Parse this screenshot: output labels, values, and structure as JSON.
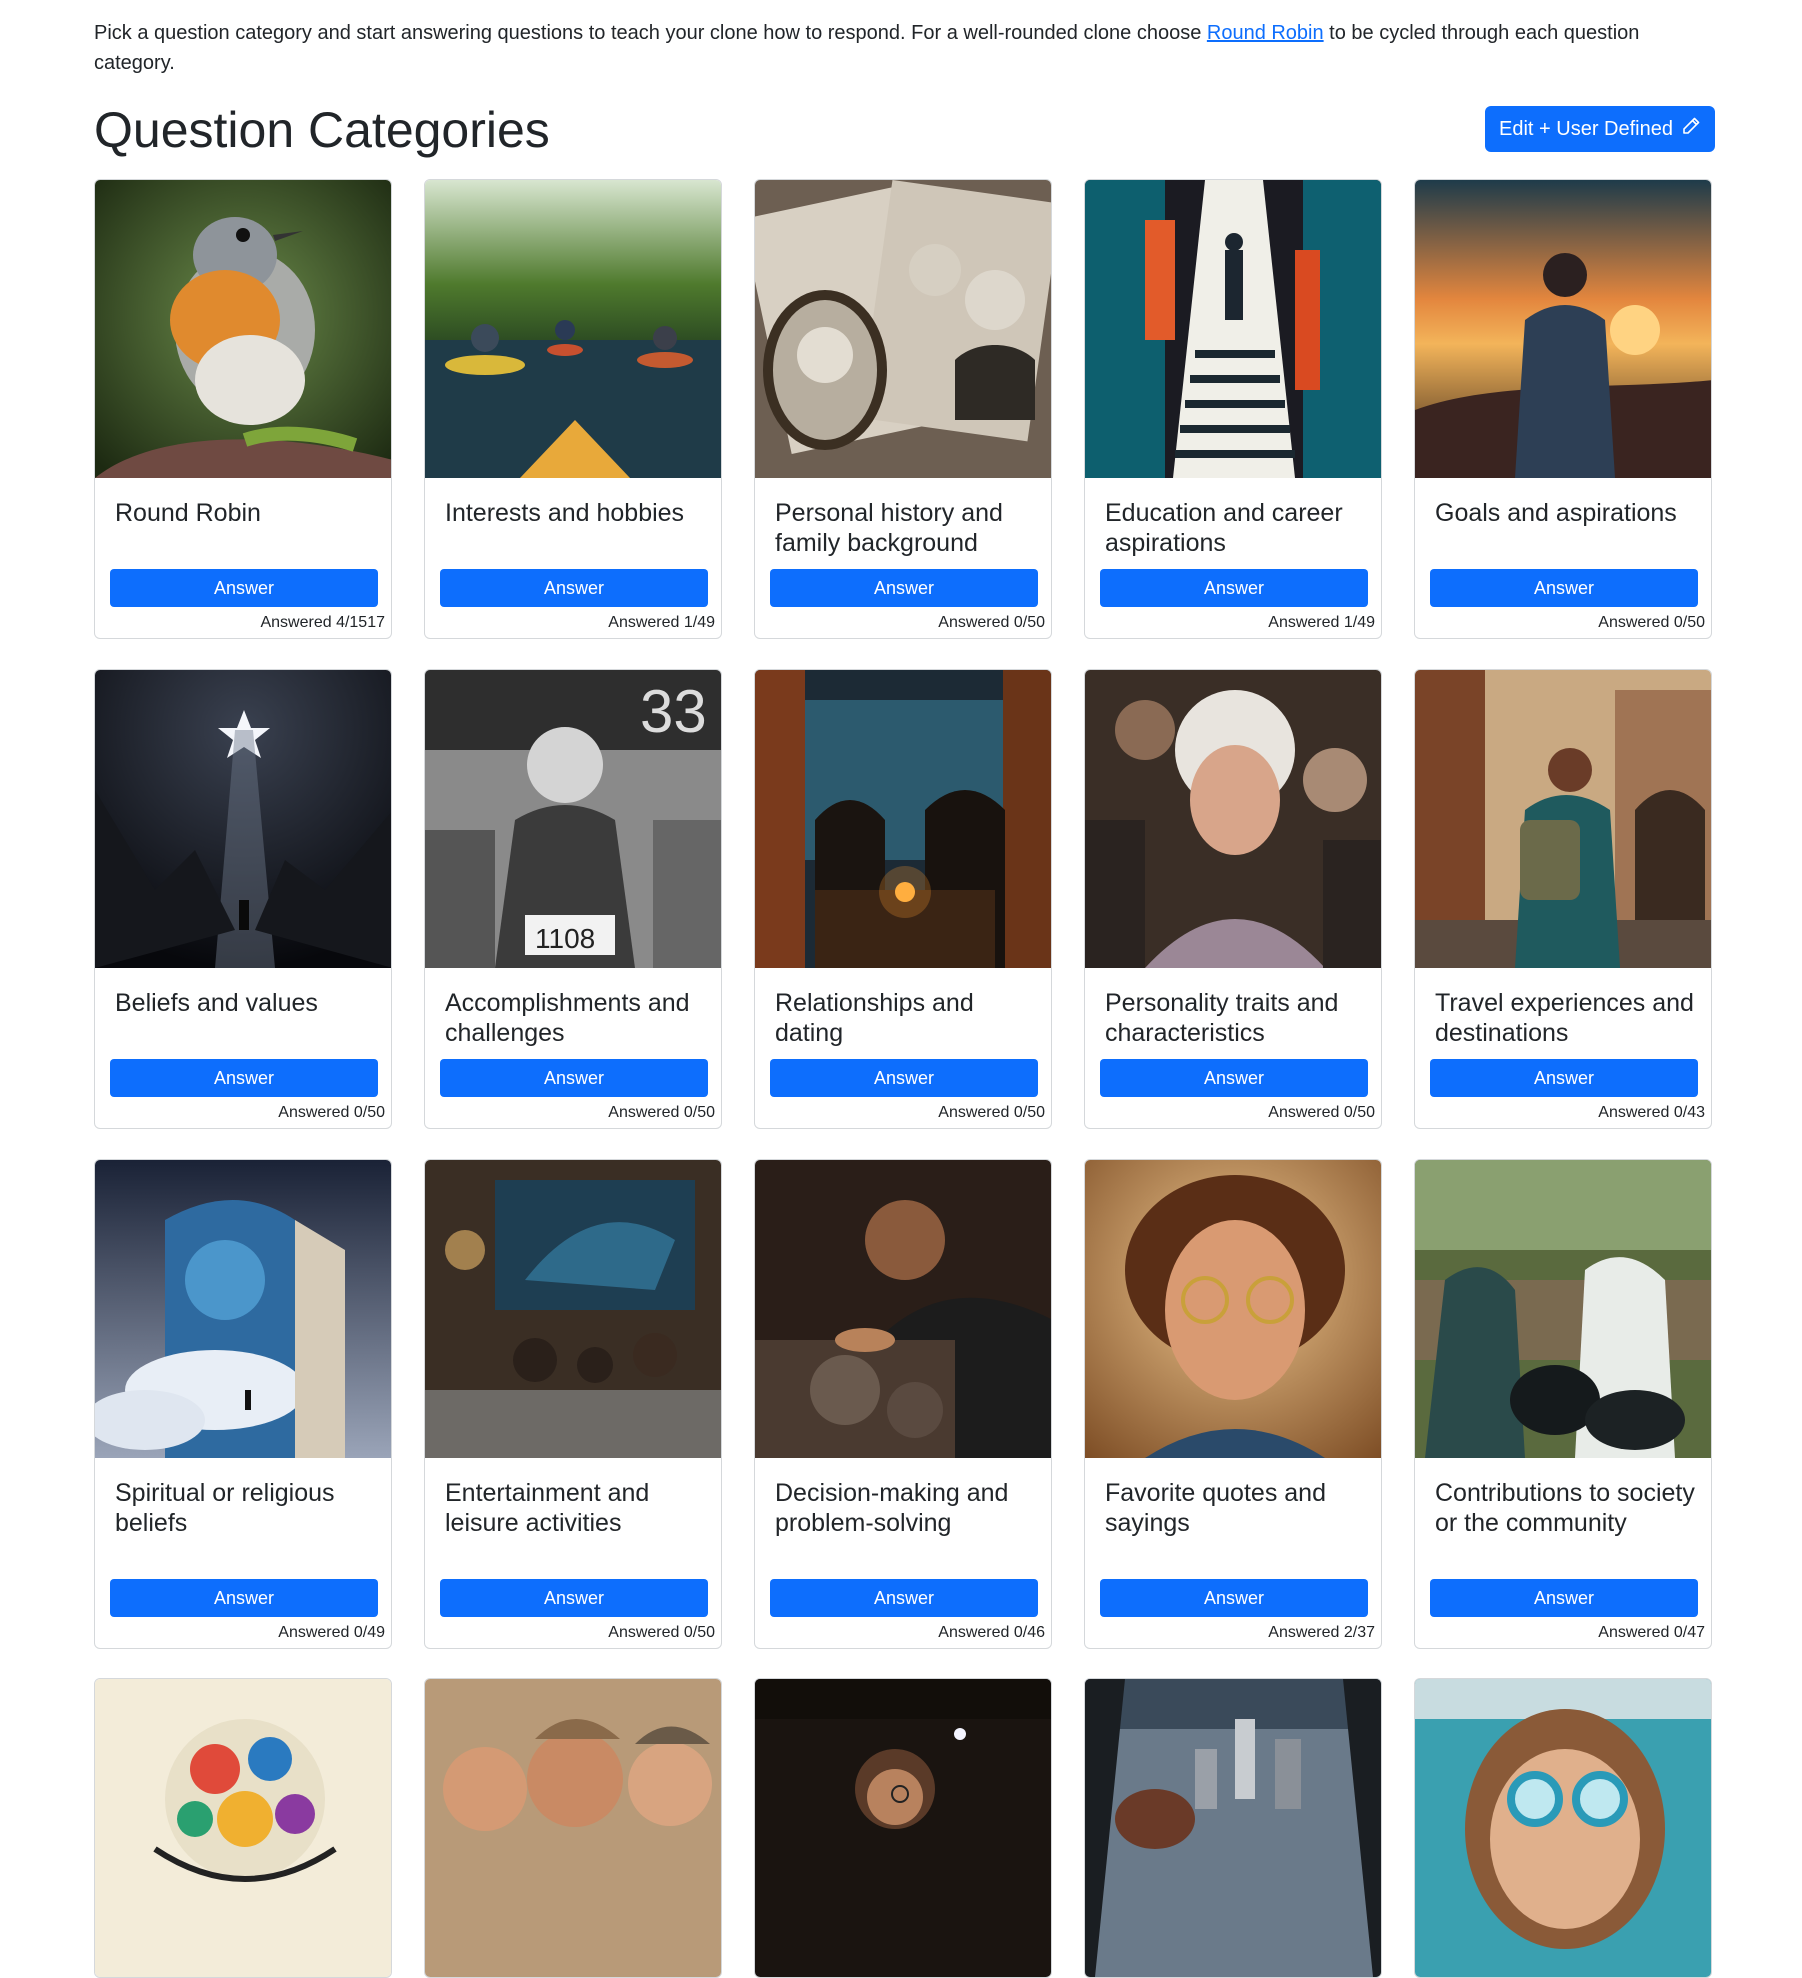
{
  "intro": {
    "before": "Pick a question category and start answering questions to teach your clone how to respond. For a well-rounded clone choose ",
    "link": "Round Robin",
    "after": " to be cycled through each question category."
  },
  "page_title": "Question Categories",
  "edit_button_label": "Edit + User Defined",
  "answer_label": "Answer",
  "categories": [
    {
      "title": "Round Robin",
      "answered": "Answered 4/1517",
      "icon": "robin-bird-photo"
    },
    {
      "title": "Interests and hobbies",
      "answered": "Answered 1/49",
      "icon": "kayakers-river-photo"
    },
    {
      "title": "Personal history and family background",
      "answered": "Answered 0/50",
      "icon": "vintage-family-portraits-photo"
    },
    {
      "title": "Education and career aspirations",
      "answered": "Answered 1/49",
      "icon": "man-climbing-stairs-art"
    },
    {
      "title": "Goals and aspirations",
      "answered": "Answered 0/50",
      "icon": "person-at-sunset-photo"
    },
    {
      "title": "Beliefs and values",
      "answered": "Answered 0/50",
      "icon": "star-over-mountains-photo"
    },
    {
      "title": "Accomplishments and challenges",
      "answered": "Answered 0/50",
      "icon": "runner-finishing-race-photo"
    },
    {
      "title": "Relationships and dating",
      "answered": "Answered 0/50",
      "icon": "couple-candlelit-dinner-photo"
    },
    {
      "title": "Personality traits and characteristics",
      "answered": "Answered 0/50",
      "icon": "laughing-woman-photo"
    },
    {
      "title": "Travel experiences and destinations",
      "answered": "Answered 0/43",
      "icon": "backpacker-old-city-photo"
    },
    {
      "title": "Spiritual or religious beliefs",
      "answered": "Answered 0/49",
      "icon": "door-to-cosmos-art"
    },
    {
      "title": "Entertainment and leisure activities",
      "answered": "Answered 0/50",
      "icon": "family-watching-tv-photo"
    },
    {
      "title": "Decision-making and problem-solving",
      "answered": "Answered 0/46",
      "icon": "mechanic-engine-photo"
    },
    {
      "title": "Favorite quotes and sayings",
      "answered": "Answered 2/37",
      "icon": "man-with-glasses-portrait"
    },
    {
      "title": "Contributions to society or the community",
      "answered": "Answered 0/47",
      "icon": "volunteers-cleanup-photo"
    },
    {
      "title": "",
      "answered": "",
      "icon": "colorful-globe-art"
    },
    {
      "title": "",
      "answered": "",
      "icon": "laughing-friends-photo"
    },
    {
      "title": "",
      "answered": "",
      "icon": "woman-reading-night-photo"
    },
    {
      "title": "",
      "answered": "",
      "icon": "city-aerial-view-photo"
    },
    {
      "title": "",
      "answered": "",
      "icon": "child-with-goggles-photo"
    }
  ]
}
